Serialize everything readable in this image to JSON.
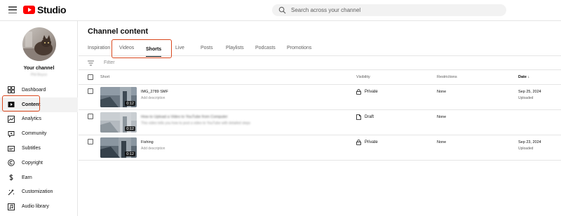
{
  "app": {
    "name": "Studio"
  },
  "search": {
    "placeholder": "Search across your channel"
  },
  "sidebar": {
    "channel_title": "Your channel",
    "channel_handle": "Phil Boyce",
    "items": [
      {
        "label": "Dashboard",
        "icon": "dashboard-icon"
      },
      {
        "label": "Content",
        "icon": "content-icon",
        "active": true
      },
      {
        "label": "Analytics",
        "icon": "analytics-icon"
      },
      {
        "label": "Community",
        "icon": "community-icon"
      },
      {
        "label": "Subtitles",
        "icon": "subtitles-icon"
      },
      {
        "label": "Copyright",
        "icon": "copyright-icon"
      },
      {
        "label": "Earn",
        "icon": "earn-icon"
      },
      {
        "label": "Customization",
        "icon": "customization-icon"
      },
      {
        "label": "Audio library",
        "icon": "audio-library-icon"
      }
    ]
  },
  "main": {
    "title": "Channel content",
    "tabs": [
      {
        "label": "Inspiration"
      },
      {
        "label": "Videos"
      },
      {
        "label": "Shorts",
        "active": true
      },
      {
        "label": "Live"
      },
      {
        "label": "Posts"
      },
      {
        "label": "Playlists"
      },
      {
        "label": "Podcasts"
      },
      {
        "label": "Promotions"
      }
    ],
    "filter": {
      "placeholder": "Filter"
    },
    "columns": {
      "short": "Short",
      "visibility": "Visibility",
      "restrictions": "Restrictions",
      "date": "Date"
    },
    "rows": [
      {
        "title": "IMG_2789 SMF",
        "description": "Add description",
        "duration": "0:12",
        "visibility": "Private",
        "visibility_icon": "lock-icon",
        "restrictions": "None",
        "date": "Sep 25, 2024",
        "date_status": "Uploaded"
      },
      {
        "title": "How to Upload a Video to YouTube from Computer",
        "description": "This video tells you how to post a video to YouTube with detailed steps",
        "duration": "0:12",
        "visibility": "Draft",
        "visibility_icon": "draft-file-icon",
        "restrictions": "None",
        "date": "",
        "date_status": ""
      },
      {
        "title": "Fishing",
        "description": "Add description",
        "duration": "0:12",
        "visibility": "Private",
        "visibility_icon": "lock-icon",
        "restrictions": "None",
        "date": "Sep 23, 2024",
        "date_status": "Uploaded"
      }
    ]
  },
  "colors": {
    "brand_red": "#ff0000",
    "highlight_box": "#d9471d",
    "active_nav_bg": "#f2f2f2",
    "divider": "#e5e5e5"
  }
}
